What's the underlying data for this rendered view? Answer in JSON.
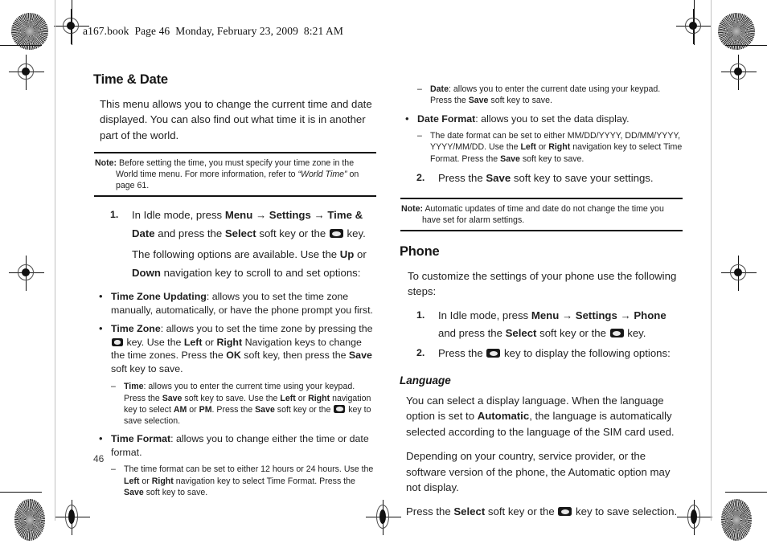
{
  "page": {
    "header_line": "a167.book  Page 46  Monday, February 23, 2009  8:21 AM",
    "folio": "46"
  },
  "left_column": {
    "section_title": "Time & Date",
    "intro": "This menu allows you to change the current time and date displayed. You can also find out what time it is in another part of the world.",
    "note": {
      "label": "Note:",
      "text_1": "Before setting the time, you must specify your time zone in the World time menu. For more information, refer to ",
      "text_italic": "“World Time”",
      "text_2": " on page 61."
    },
    "step1": {
      "number": "1.",
      "text_1": "In Idle mode, press ",
      "bold_menu": "Menu",
      "arrow_1": "→",
      "bold_settings": "Settings",
      "arrow_2": "→",
      "bold_timedate": "Time & Date",
      "text_2": " and press the ",
      "bold_select": "Select",
      "text_3": " soft key or the ",
      "icon": "confirm-key-icon",
      "text_4": " key."
    },
    "options_intro": {
      "text_1": "The following options are available. Use the ",
      "bold_up": "Up",
      "text_2": " or ",
      "bold_down": "Down",
      "text_3": " navigation key to scroll to and set options:"
    },
    "bullets": [
      {
        "marker": "•",
        "bold": "Time Zone Updating",
        "text": ": allows you to set the time zone manually, automatically, or have the phone prompt you first."
      },
      {
        "marker": "•",
        "bold": "Time Zone",
        "text_1": ": allows you to set the time zone by pressing the ",
        "icon": "confirm-key-icon",
        "text_2": " key. Use the ",
        "bold_left": "Left",
        "text_3": " or ",
        "bold_right": "Right",
        "text_4": " Navigation keys to change the time zones. Press the ",
        "bold_ok": "OK",
        "text_5": " soft key, then press the ",
        "bold_save": "Save",
        "text_6": " soft key to save."
      },
      {
        "marker": "•",
        "bold": "Time Format",
        "text": ": allows you to change either the time or date format."
      }
    ],
    "dash_time": {
      "marker": "–",
      "bold": "Time",
      "text_1": ": allows you to enter the current time using your keypad. Press the ",
      "bold_save_1": "Save",
      "text_2": " soft key to save. Use the ",
      "bold_left": "Left",
      "text_3": " or ",
      "bold_right": "Right",
      "text_4": " navigation key to select ",
      "bold_am": "AM",
      "text_5": " or ",
      "bold_pm": "PM",
      "text_6": ". Press the ",
      "bold_save_2": "Save",
      "text_7": " soft key or the ",
      "icon": "confirm-key-icon",
      "text_8": " key to save selection."
    },
    "dash_timeformat": {
      "marker": "–",
      "text_1": "The time format can be set to either 12 hours or 24 hours. Use the ",
      "bold_left": "Left",
      "text_2": " or ",
      "bold_right": "Right",
      "text_3": " navigation key to select Time Format. Press the ",
      "bold_save": "Save",
      "text_4": " soft key to save."
    }
  },
  "right_column": {
    "dash_date": {
      "marker": "–",
      "bold": "Date",
      "text_1": ": allows you to enter the current date using your keypad. Press the ",
      "bold_save": "Save",
      "text_2": " soft key to save."
    },
    "bullet_dateformat": {
      "marker": "•",
      "bold": "Date Format",
      "text": ": allows you to set the data display."
    },
    "dash_dateformat": {
      "marker": "–",
      "text_1": "The date format can be set to either MM/DD/YYYY, DD/MM/YYYY, YYYY/MM/DD. Use the ",
      "bold_left": "Left",
      "text_2": " or ",
      "bold_right": "Right",
      "text_3": " navigation key to select Time Format. Press the ",
      "bold_save": "Save",
      "text_4": " soft key to save."
    },
    "step2": {
      "number": "2.",
      "text_1": "Press the ",
      "bold_save": "Save",
      "text_2": " soft key to save your settings."
    },
    "note": {
      "label": "Note:",
      "text": "Automatic updates of time and date do not change the time you have set for alarm settings."
    },
    "section_title": "Phone",
    "phone_intro": "To customize the settings of your phone use the following steps:",
    "phone_step1": {
      "number": "1.",
      "text_1": "In Idle mode, press ",
      "bold_menu": "Menu",
      "arrow_1": "→",
      "bold_settings": "Settings",
      "arrow_2": "→",
      "bold_phone": "Phone",
      "text_2": " and press the ",
      "bold_select": "Select",
      "text_3": " soft key or the ",
      "icon": "confirm-key-icon",
      "text_4": " key."
    },
    "phone_step2": {
      "number": "2.",
      "text_1": "Press the ",
      "icon": "confirm-key-icon",
      "text_2": " key to display the following options:"
    },
    "language_heading": "Language",
    "language_p1": {
      "text_1": "You can select a display language. When the language option is set to ",
      "bold_automatic": "Automatic",
      "text_2": ", the language is automatically selected according to the language of the SIM card used."
    },
    "language_p2": "Depending on your country, service provider, or the software version of the phone, the Automatic option may not display.",
    "language_p3": {
      "text_1": "Press the ",
      "bold_select": "Select",
      "text_2": " soft key or the ",
      "icon": "confirm-key-icon",
      "text_3": " key to save selection."
    }
  }
}
